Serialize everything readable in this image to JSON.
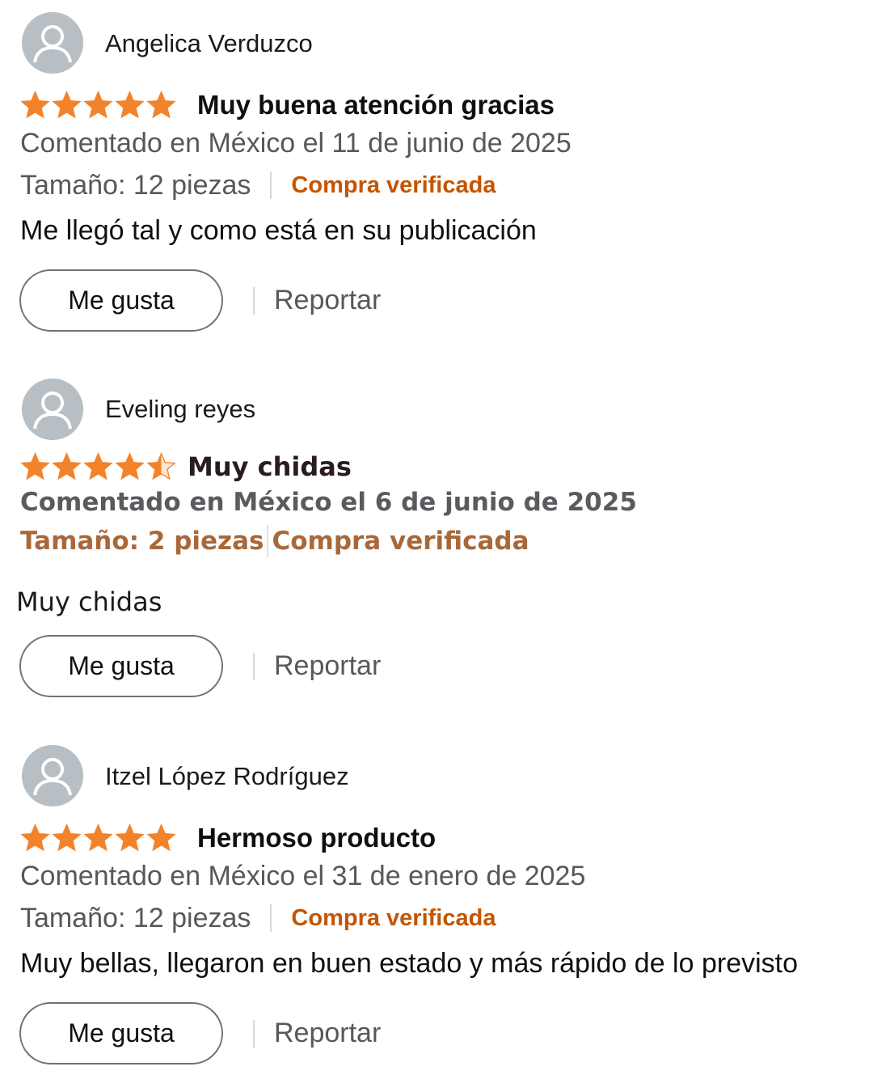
{
  "reviews": [
    {
      "reviewer": "Angelica Verduzco",
      "rating": 5,
      "title": "Muy buena atención gracias",
      "date": "Comentado en México el 11 de junio de 2025",
      "size": "Tamaño: 12 piezas",
      "verified": "Compra verificada",
      "body": "Me llegó tal y como está en su publicación",
      "like_label": "Me gusta",
      "report_label": "Reportar"
    },
    {
      "reviewer": "Eveling reyes",
      "rating": 4.5,
      "title": "Muy chidas",
      "date": "Comentado en México el 6 de junio de 2025",
      "size": "Tamaño: 2 piezas",
      "verified": "Compra verificada",
      "body": "Muy chidas",
      "like_label": "Me gusta",
      "report_label": "Reportar"
    },
    {
      "reviewer": "Itzel López Rodríguez",
      "rating": 5,
      "title": "Hermoso producto",
      "date": "Comentado en México el 31 de enero de 2025",
      "size": "Tamaño: 12 piezas",
      "verified": "Compra verificada",
      "body": "Muy bellas, llegaron en buen estado y más rápido de lo previsto",
      "like_label": "Me gusta",
      "report_label": "Reportar"
    }
  ],
  "icons": {
    "avatar": "user-avatar-icon",
    "star": "star-icon"
  },
  "colors": {
    "star": "#f3832b",
    "verified": "#c45500",
    "meta_text": "#565959",
    "avatar_bg": "#b7bfc4"
  }
}
